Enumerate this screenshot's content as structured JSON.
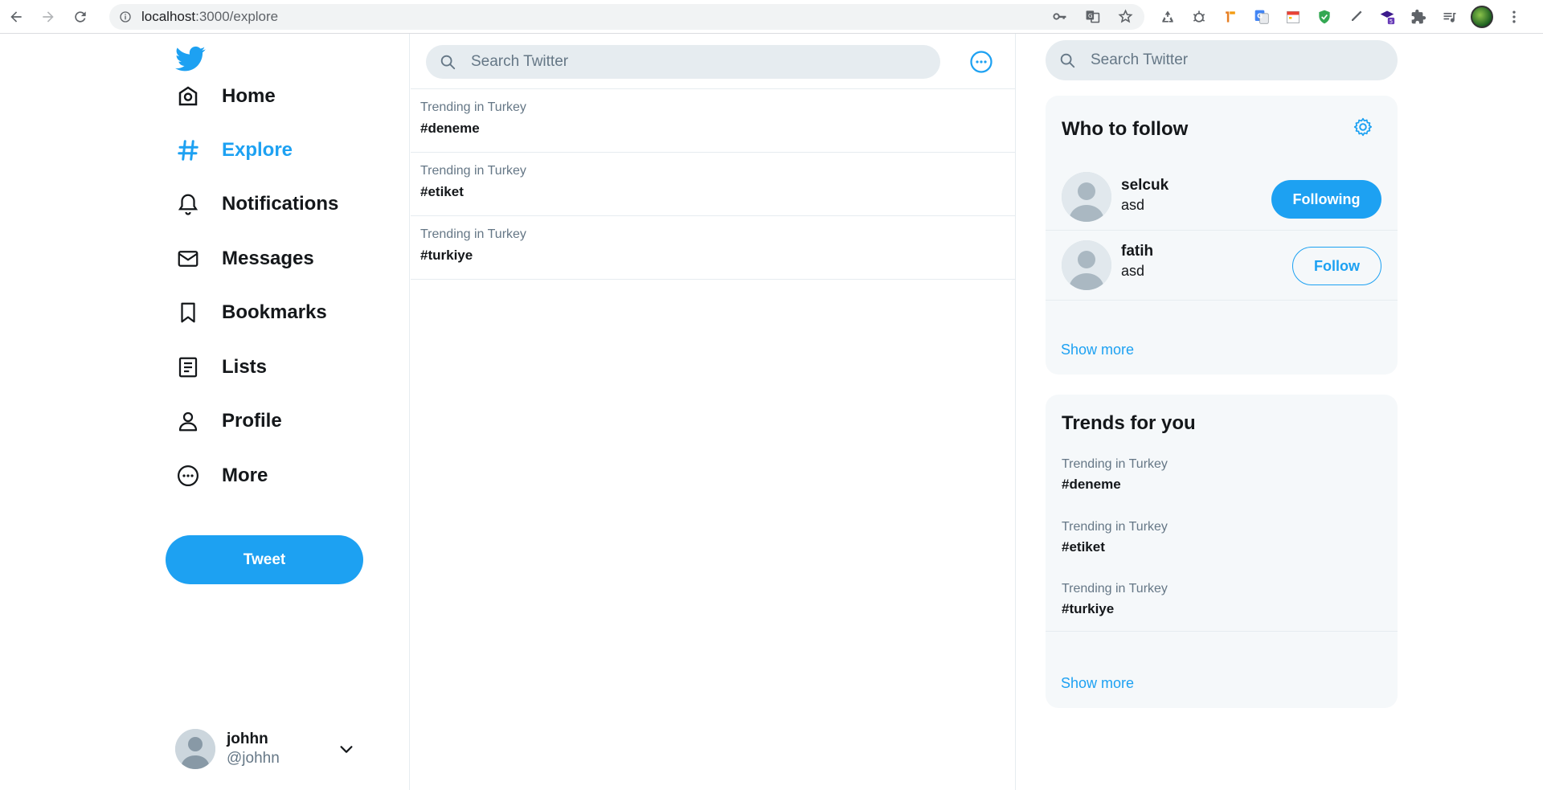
{
  "browser": {
    "url_host": "localhost",
    "url_path": ":3000/explore"
  },
  "sidebar": {
    "items": [
      {
        "label": "Home",
        "icon": "home-icon"
      },
      {
        "label": "Explore",
        "icon": "hashtag-icon",
        "active": true
      },
      {
        "label": "Notifications",
        "icon": "bell-icon"
      },
      {
        "label": "Messages",
        "icon": "envelope-icon"
      },
      {
        "label": "Bookmarks",
        "icon": "bookmark-icon"
      },
      {
        "label": "Lists",
        "icon": "list-icon"
      },
      {
        "label": "Profile",
        "icon": "person-icon"
      },
      {
        "label": "More",
        "icon": "more-circle-icon"
      }
    ],
    "tweet_label": "Tweet",
    "user": {
      "name": "johhn",
      "handle": "@johhn"
    }
  },
  "center": {
    "search_placeholder": "Search Twitter",
    "trends": [
      {
        "context": "Trending in Turkey",
        "tag": "#deneme"
      },
      {
        "context": "Trending in Turkey",
        "tag": "#etiket"
      },
      {
        "context": "Trending in Turkey",
        "tag": "#turkiye"
      }
    ]
  },
  "right": {
    "search_placeholder": "Search Twitter",
    "who_to_follow": {
      "title": "Who to follow",
      "users": [
        {
          "name": "selcuk",
          "handle": "asd",
          "button": "Following"
        },
        {
          "name": "fatih",
          "handle": "asd",
          "button": "Follow"
        }
      ],
      "show_more": "Show more"
    },
    "trends": {
      "title": "Trends for you",
      "items": [
        {
          "context": "Trending in Turkey",
          "tag": "#deneme"
        },
        {
          "context": "Trending in Turkey",
          "tag": "#etiket"
        },
        {
          "context": "Trending in Turkey",
          "tag": "#turkiye"
        }
      ],
      "show_more": "Show more"
    }
  },
  "colors": {
    "accent": "#1da1f2",
    "text": "#14171a",
    "muted": "#657786",
    "panel": "#f5f8fa"
  }
}
